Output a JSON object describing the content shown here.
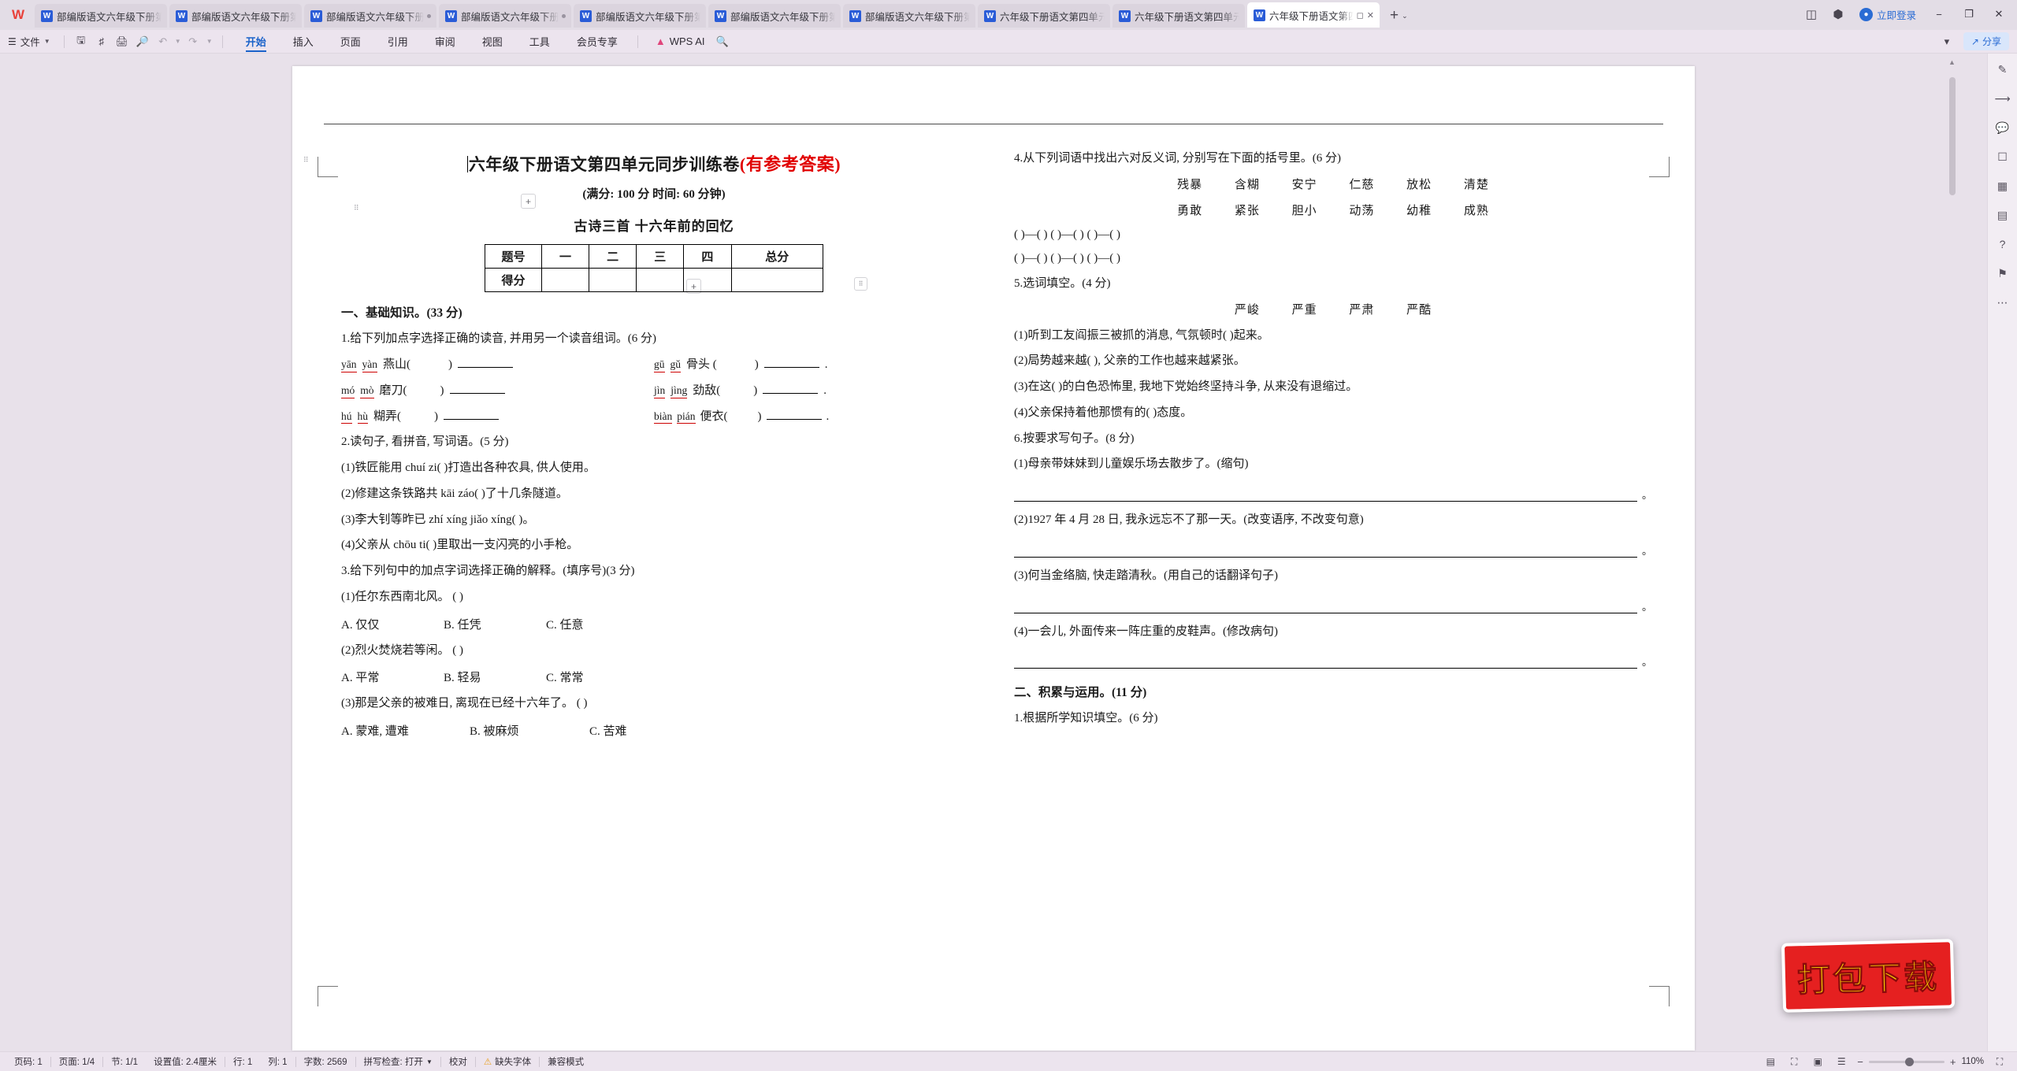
{
  "window": {
    "logo": "W",
    "tabs": [
      {
        "label": "部编版语文六年级下册第四单元",
        "icon": "W",
        "active": false,
        "dot": false
      },
      {
        "label": "部编版语文六年级下册第四单元",
        "icon": "W",
        "active": false,
        "dot": false
      },
      {
        "label": "部编版语文六年级下册第四单元",
        "icon": "W",
        "active": false,
        "dot": true
      },
      {
        "label": "部编版语文六年级下册第四单元",
        "icon": "W",
        "active": false,
        "dot": true
      },
      {
        "label": "部编版语文六年级下册第四单元",
        "icon": "W",
        "active": false,
        "dot": false
      },
      {
        "label": "部编版语文六年级下册第四单元",
        "icon": "W",
        "active": false,
        "dot": false
      },
      {
        "label": "部编版语文六年级下册第四单元",
        "icon": "W",
        "active": false,
        "dot": false
      },
      {
        "label": "六年级下册语文第四单元达标测",
        "icon": "W",
        "active": false,
        "dot": false
      },
      {
        "label": "六年级下册语文第四单元同步训",
        "icon": "W",
        "active": false,
        "dot": false
      },
      {
        "label": "六年级下册语文第四单元",
        "icon": "W",
        "active": true,
        "dot": false
      }
    ],
    "new_tab": "+",
    "new_tab_chevron": "⌄",
    "login_label": "立即登录",
    "minimize": "−",
    "maximize": "❐",
    "close": "✕"
  },
  "ribbon": {
    "file_label": "文件",
    "quick_icons": [
      "save-icon",
      "save-as-icon",
      "print-icon",
      "print-preview-icon",
      "undo-icon",
      "redo-icon",
      "customize-icon"
    ],
    "tabs": [
      {
        "label": "开始",
        "active": true
      },
      {
        "label": "插入",
        "active": false
      },
      {
        "label": "页面",
        "active": false
      },
      {
        "label": "引用",
        "active": false
      },
      {
        "label": "审阅",
        "active": false
      },
      {
        "label": "视图",
        "active": false
      },
      {
        "label": "工具",
        "active": false
      },
      {
        "label": "会员专享",
        "active": false
      }
    ],
    "ai_label": "WPS AI",
    "share_label": "分享"
  },
  "document": {
    "title_main": "六年级下册语文第四单元同步训练卷",
    "title_red": "(有参考答案)",
    "subtitle": "(满分: 100 分   时间: 60 分钟)",
    "lesson_line": "古诗三首     十六年前的回忆",
    "score_table": {
      "headers": [
        "题号",
        "一",
        "二",
        "三",
        "四",
        "总分"
      ],
      "rows": [
        [
          "得分",
          "",
          "",
          "",
          "",
          ""
        ]
      ]
    },
    "section_one": "一、基础知识。(33 分)",
    "q1": {
      "prompt": "1.给下列加点字选择正确的读音, 并用另一个读音组词。(6 分)",
      "items": [
        {
          "py1": "yān",
          "py2": "yàn",
          "word": "燕山(",
          "close": ")"
        },
        {
          "py1": "gū",
          "py2": "gǔ",
          "word": "骨头 (",
          "close": ")"
        },
        {
          "py1": "mó",
          "py2": "mò",
          "word": "磨刀(",
          "close": ")"
        },
        {
          "py1": "jìn",
          "py2": "jìng",
          "word": "劲敌(",
          "close": ")"
        },
        {
          "py1": "hú",
          "py2": "hù",
          "word": "糊弄(",
          "close": ")"
        },
        {
          "py1": "biàn",
          "py2": "pián",
          "word": "便衣(",
          "close": ")"
        }
      ]
    },
    "q2": {
      "prompt": "2.读句子, 看拼音, 写词语。(5 分)",
      "items": [
        "(1)铁匠能用 chuí zi(          )打造出各种农具, 供人使用。",
        "(2)修建这条铁路共 kāi záo(          )了十几条隧道。",
        "(3)李大钊等昨已 zhí xíng jiǎo xíng(          )。",
        "(4)父亲从 chōu ti(          )里取出一支闪亮的小手枪。"
      ]
    },
    "q3": {
      "prompt": "3.给下列句中的加点字词选择正确的解释。(填序号)(3 分)",
      "items": [
        {
          "stem": "(1)任尔东西南北风。      (      )",
          "options": [
            "A. 仅仅",
            "B. 任凭",
            "C. 任意"
          ]
        },
        {
          "stem": "(2)烈火焚烧若等闲。      (      )",
          "options": [
            "A. 平常",
            "B. 轻易",
            "C. 常常"
          ]
        },
        {
          "stem": "(3)那是父亲的被难日, 离现在已经十六年了。      (      )",
          "options": [
            "A. 蒙难, 遭难",
            "B. 被麻烦",
            "C. 苦难"
          ]
        }
      ]
    },
    "q4": {
      "prompt": "4.从下列词语中找出六对反义词, 分别写在下面的括号里。(6 分)",
      "row1": [
        "残暴",
        "含糊",
        "安宁",
        "仁慈",
        "放松",
        "清楚"
      ],
      "row2": [
        "勇敢",
        "紧张",
        "胆小",
        "动荡",
        "幼稚",
        "成熟"
      ],
      "answer_rows": [
        "(        )—(        )    (        )—(        )    (        )—(        )",
        "(        )—(        )    (        )—(        )    (        )—(        )"
      ]
    },
    "q5": {
      "prompt": "5.选词填空。(4 分)",
      "words": [
        "严峻",
        "严重",
        "严肃",
        "严酷"
      ],
      "items": [
        "(1)听到工友阎振三被抓的消息, 气氛顿时(        )起来。",
        "(2)局势越来越(        ), 父亲的工作也越来越紧张。",
        "(3)在这(        )的白色恐怖里, 我地下党始终坚持斗争, 从来没有退缩过。",
        "(4)父亲保持着他那惯有的(        )态度。"
      ]
    },
    "q6": {
      "prompt": "6.按要求写句子。(8 分)",
      "items": [
        "(1)母亲带妹妹到儿童娱乐场去散步了。(缩句)",
        "(2)1927 年 4 月 28 日, 我永远忘不了那一天。(改变语序, 不改变句意)",
        "(3)何当金络脑, 快走踏清秋。(用自己的话翻译句子)",
        "(4)一会儿, 外面传来一阵庄重的皮鞋声。(修改病句)"
      ],
      "period": "。"
    },
    "section_two": "二、积累与运用。(11 分)",
    "q7": "1.根据所学知识填空。(6 分)"
  },
  "watermark": {
    "text": "打包下载"
  },
  "status": {
    "items": [
      "页码: 1",
      "页面: 1/4",
      "节: 1/1",
      "设置值: 2.4厘米",
      "行: 1",
      "列: 1",
      "字数: 2569",
      "拼写检查: 打开",
      "校对",
      "缺失字体",
      "兼容模式"
    ],
    "zoom_value": "110%",
    "zoom_minus": "−",
    "zoom_plus": "+"
  },
  "rail": {
    "icons": [
      "pen-icon",
      "cursor-icon",
      "comment-icon",
      "picture-icon",
      "table-icon",
      "chart-icon",
      "help-icon",
      "bookmark-icon",
      "more-icon"
    ]
  }
}
